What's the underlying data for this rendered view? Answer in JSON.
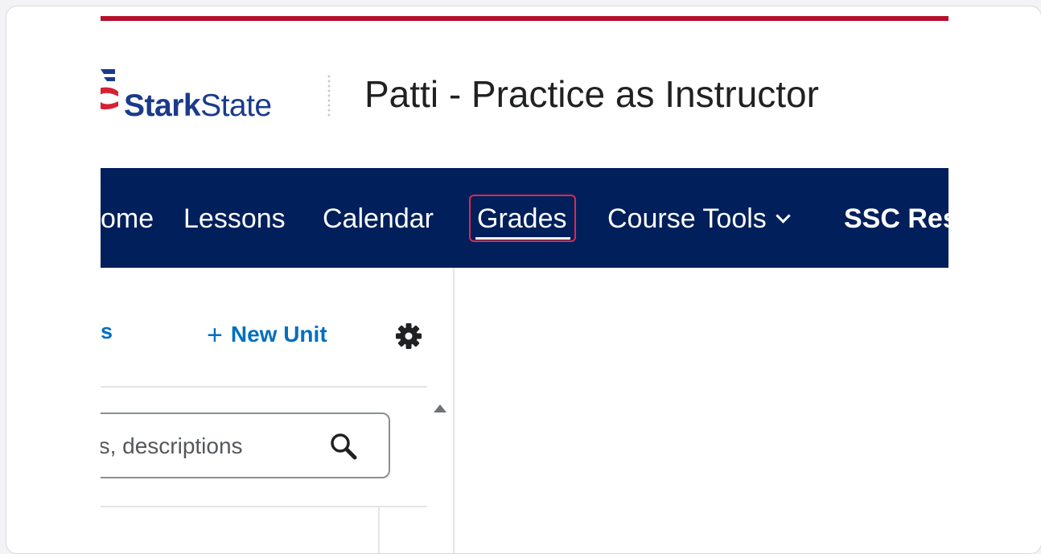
{
  "brand": {
    "logo_name_bold": "Stark",
    "logo_name_light": "State",
    "colors": {
      "accent_red": "#b5102b",
      "brand_blue": "#1a3a8c",
      "nav_bg": "#001f5b",
      "link_blue": "#006fbf",
      "highlight": "#e0294a"
    }
  },
  "header": {
    "course_title": "Patti - Practice as Instructor"
  },
  "nav": {
    "items": [
      {
        "label": "ome"
      },
      {
        "label": "Lessons"
      },
      {
        "label": "Calendar"
      },
      {
        "label": "Grades"
      },
      {
        "label": "Course Tools"
      },
      {
        "label": "SSC Res"
      }
    ],
    "active": "Grades"
  },
  "lessons_panel": {
    "tab_fragment": "s",
    "new_unit_label": "New Unit",
    "new_unit_icon": "plus-icon",
    "settings_icon": "gear-icon",
    "search": {
      "placeholder_visible": "es, descriptions",
      "icon": "search-icon"
    }
  }
}
